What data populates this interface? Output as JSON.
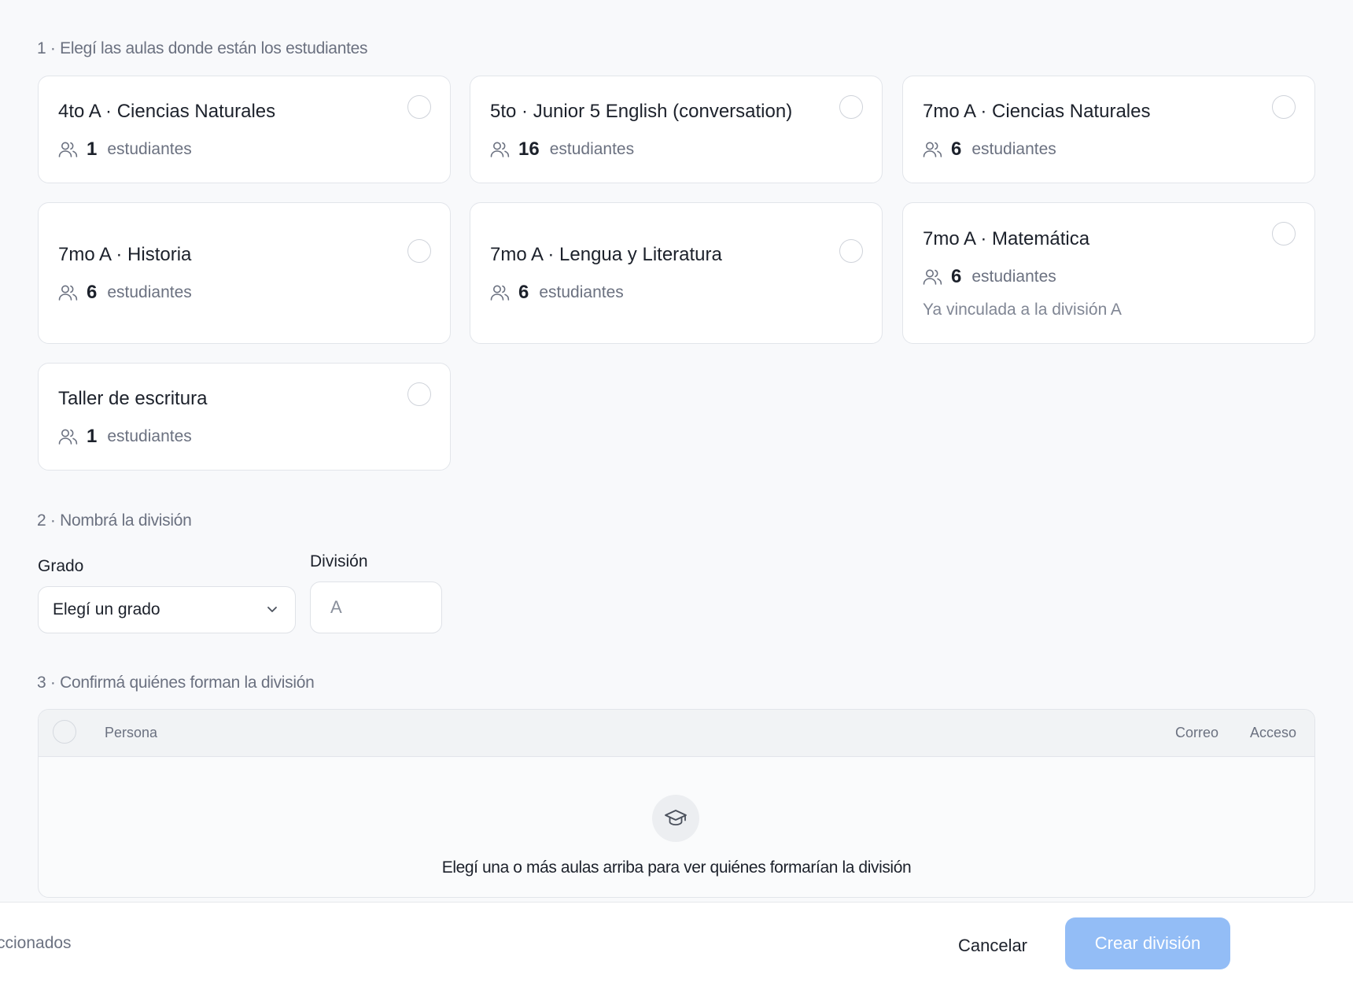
{
  "step1": {
    "title": "1 · Elegí las aulas donde están los estudiantes",
    "count_label": "estudiantes",
    "classrooms": [
      {
        "name": "4to A · Ciencias Naturales",
        "count": "1"
      },
      {
        "name": "5to · Junior 5 English (conversation)",
        "count": "16"
      },
      {
        "name": "7mo A · Ciencias Naturales",
        "count": "6"
      },
      {
        "name": "7mo A · Historia",
        "count": "6"
      },
      {
        "name": "7mo A · Lengua y Literatura",
        "count": "6"
      },
      {
        "name": "7mo A · Matemática",
        "count": "6",
        "note": "Ya vinculada a la división A"
      },
      {
        "name": "Taller de escritura",
        "count": "1"
      }
    ]
  },
  "step2": {
    "title": "2 · Nombrá la división",
    "grade_label": "Grado",
    "grade_value": "Elegí un grado",
    "division_label": "División",
    "division_placeholder": "A"
  },
  "step3": {
    "title": "3 · Confirmá quiénes forman la división",
    "columns": {
      "person": "Persona",
      "email": "Correo",
      "access": "Acceso"
    },
    "empty_message": "Elegí una o más aulas arriba para ver quiénes formarían la división"
  },
  "footer": {
    "selected_text": "ccionados",
    "cancel_label": "Cancelar",
    "create_label": "Crear división"
  },
  "colors": {
    "primary_disabled": "#93bdf6",
    "background": "#f8f9fb"
  }
}
